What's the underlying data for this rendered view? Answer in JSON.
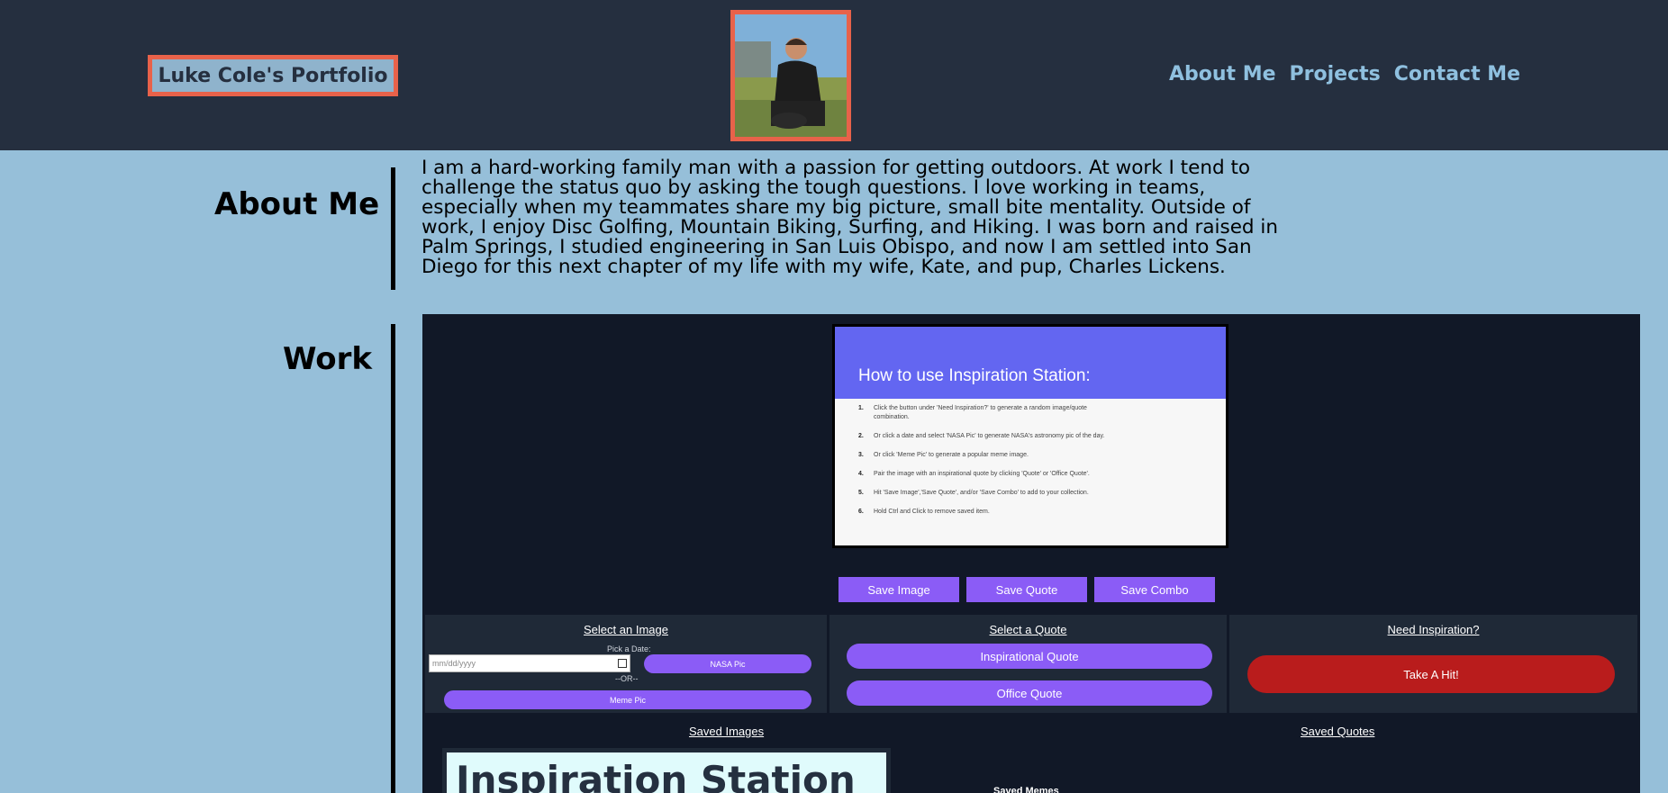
{
  "header": {
    "brand": "Luke Cole's Portfolio",
    "nav": [
      "About Me",
      "Projects",
      "Contact Me"
    ]
  },
  "about": {
    "title": "About Me",
    "text": "I am a hard-working family man with a passion for getting outdoors. At work I tend to challenge the status quo by asking the tough questions. I love working in teams, especially when my teammates share my big picture, small bite mentality. Outside of work, I enjoy Disc Golfing, Mountain Biking, Surfing, and Hiking. I was born and raised in Palm Springs, I studied engineering in San Luis Obispo, and now I am settled into San Diego for this next chapter of my life with my wife, Kate, and pup, Charles Lickens."
  },
  "work": {
    "title": "Work",
    "project": {
      "card_title": "How to use Inspiration Station:",
      "steps": [
        {
          "num": "1.",
          "text": "Click the button under 'Need Inspiration?' to generate a random image/quote combination."
        },
        {
          "num": "2.",
          "text": "Or click a date and select 'NASA Pic' to generate NASA's astronomy pic of the day."
        },
        {
          "num": "3.",
          "text": "Or click 'Meme Pic' to generate a popular meme image."
        },
        {
          "num": "4.",
          "text": "Pair the image with an inspirational quote by clicking 'Quote' or 'Office Quote'."
        },
        {
          "num": "5.",
          "text": "Hit 'Save Image','Save Quote', and/or 'Save Combo' to add to your collection."
        },
        {
          "num": "6.",
          "text": "Hold Ctrl and Click to remove saved item."
        }
      ],
      "save_buttons": [
        "Save Image",
        "Save Quote",
        "Save Combo"
      ],
      "select_image": {
        "title": "Select an Image",
        "date_label": "Pick a Date:",
        "date_placeholder": "mm/dd/yyyy",
        "nasa_button": "NASA Pic",
        "or_text": "--OR--",
        "meme_button": "Meme Pic"
      },
      "select_quote": {
        "title": "Select a Quote",
        "inspirational_button": "Inspirational Quote",
        "office_button": "Office Quote"
      },
      "need_inspiration": {
        "title": "Need Inspiration?",
        "button": "Take A Hit!"
      },
      "saved_images_title": "Saved Images",
      "saved_quotes_title": "Saved Quotes",
      "saved_memes_title": "Saved Memes",
      "saved_image_text": "Inspiration Station"
    }
  },
  "colors": {
    "header_bg": "#252f3f",
    "page_bg": "#96bfd9",
    "accent_border": "#e8624a",
    "nav_link": "#8fc0df",
    "purple_button": "#8b5cf6",
    "red_button": "#b91c1c",
    "indigo_header": "#6366f1"
  }
}
